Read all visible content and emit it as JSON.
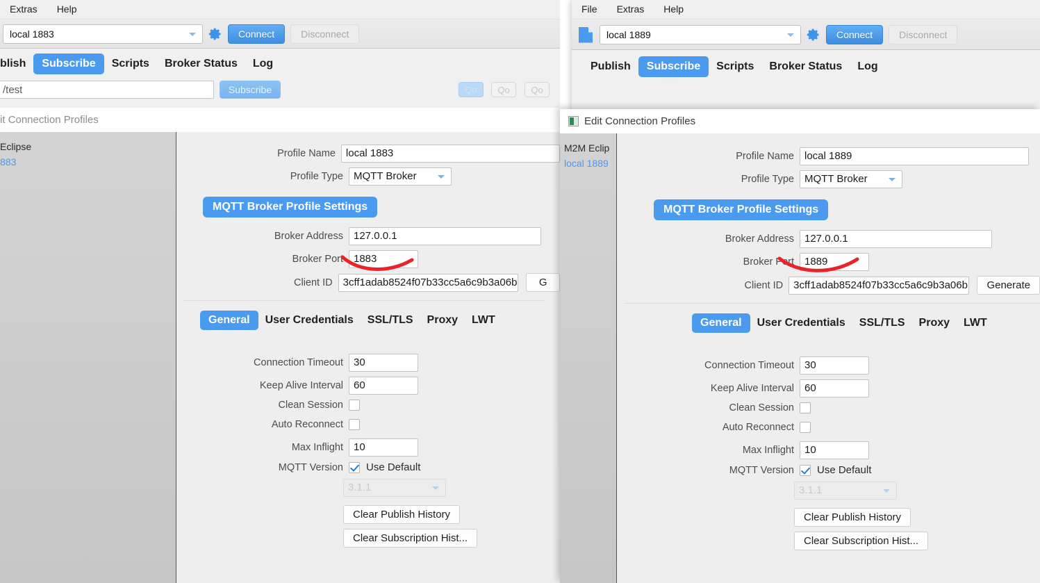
{
  "windows": {
    "back": {
      "menu": [
        "Extras",
        "Help"
      ],
      "connection": {
        "value": "local 1883",
        "gear_icon": "gear-icon"
      },
      "buttons": {
        "connect": "Connect",
        "disconnect": "Disconnect"
      },
      "tabs": [
        "blish",
        "Subscribe",
        "Scripts",
        "Broker Status",
        "Log"
      ],
      "selected_tab": "Subscribe",
      "subscribe_row": {
        "topic": "/test",
        "button": "Subscribe",
        "qos": [
          "Qo",
          "Qo",
          "Qo"
        ]
      },
      "dialog": {
        "title": "it Connection Profiles",
        "tree": [
          "Eclipse",
          "883"
        ],
        "form": {
          "profile_name_label": "Profile Name",
          "profile_name_value": "local 1883",
          "profile_type_label": "Profile Type",
          "profile_type_value": "MQTT Broker",
          "section": "MQTT Broker Profile Settings",
          "broker_address_label": "Broker Address",
          "broker_address_value": "127.0.0.1",
          "broker_port_label": "Broker Port",
          "broker_port_value": "1883",
          "client_id_label": "Client ID",
          "client_id_value": "3cff1adab8524f07b33cc5a6c9b3a06b",
          "generate_label": "G"
        },
        "subtabs": [
          "General",
          "User Credentials",
          "SSL/TLS",
          "Proxy",
          "LWT"
        ],
        "selected_subtab": "General",
        "general": {
          "connection_timeout_label": "Connection Timeout",
          "connection_timeout_value": "30",
          "keep_alive_label": "Keep Alive Interval",
          "keep_alive_value": "60",
          "clean_session_label": "Clean Session",
          "clean_session_checked": false,
          "auto_reconnect_label": "Auto Reconnect",
          "auto_reconnect_checked": false,
          "max_inflight_label": "Max Inflight",
          "max_inflight_value": "10",
          "mqtt_version_label": "MQTT Version",
          "use_default_label": "Use Default",
          "use_default_checked": true,
          "version_value": "3.1.1",
          "clear_publish": "Clear Publish History",
          "clear_subscription": "Clear Subscription Hist..."
        }
      }
    },
    "front": {
      "menu": [
        "File",
        "Extras",
        "Help"
      ],
      "connection": {
        "value": "local 1889",
        "gear_icon": "gear-icon"
      },
      "buttons": {
        "connect": "Connect",
        "disconnect": "Disconnect"
      },
      "tabs": [
        "Publish",
        "Subscribe",
        "Scripts",
        "Broker Status",
        "Log"
      ],
      "selected_tab": "Subscribe",
      "dialog": {
        "title": "Edit Connection Profiles",
        "tree": [
          "M2M Eclip",
          "local 1889"
        ],
        "form": {
          "profile_name_label": "Profile Name",
          "profile_name_value": "local 1889",
          "profile_type_label": "Profile Type",
          "profile_type_value": "MQTT Broker",
          "section": "MQTT Broker Profile Settings",
          "broker_address_label": "Broker Address",
          "broker_address_value": "127.0.0.1",
          "broker_port_label": "Broker Port",
          "broker_port_value": "1889",
          "client_id_label": "Client ID",
          "client_id_value": "3cff1adab8524f07b33cc5a6c9b3a06b",
          "generate_label": "Generate"
        },
        "subtabs": [
          "General",
          "User Credentials",
          "SSL/TLS",
          "Proxy",
          "LWT"
        ],
        "selected_subtab": "General",
        "general": {
          "connection_timeout_label": "Connection Timeout",
          "connection_timeout_value": "30",
          "keep_alive_label": "Keep Alive Interval",
          "keep_alive_value": "60",
          "clean_session_label": "Clean Session",
          "clean_session_checked": false,
          "auto_reconnect_label": "Auto Reconnect",
          "auto_reconnect_checked": false,
          "max_inflight_label": "Max Inflight",
          "max_inflight_value": "10",
          "mqtt_version_label": "MQTT Version",
          "use_default_label": "Use Default",
          "use_default_checked": true,
          "version_value": "3.1.1",
          "clear_publish": "Clear Publish History",
          "clear_subscription": "Clear Subscription Hist..."
        }
      }
    }
  },
  "annotations": {
    "color": "#e8232a",
    "marks": [
      "underline-curve-broker-port-1883",
      "underline-curve-broker-port-1889"
    ]
  },
  "colors": {
    "accent_blue": "#4a9bf0",
    "window_bg": "#f0f0f0",
    "dialog_bg": "#eeeeee",
    "tree_bg": "#cccccc",
    "annotation_red": "#e8232a"
  }
}
